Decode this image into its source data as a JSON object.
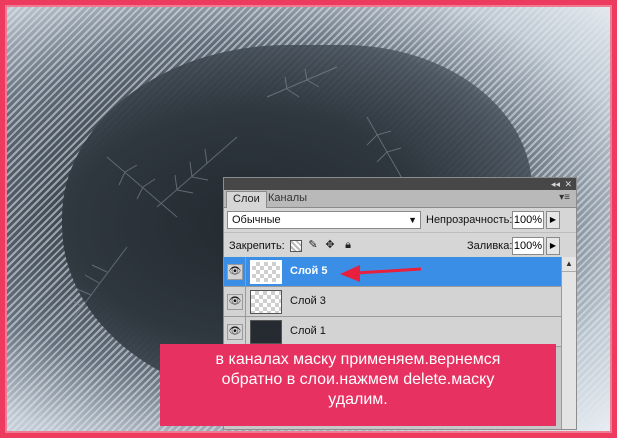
{
  "panel": {
    "tabs": [
      "Слои",
      "Каналы"
    ],
    "collapse_glyph": "◂◂",
    "close_glyph": "✕",
    "menu_glyph": "▾≡",
    "blend_mode": "Обычные",
    "opacity_label": "Непрозрачность:",
    "opacity_value": "100%",
    "lock_label": "Закрепить:",
    "fill_label": "Заливка:",
    "fill_value": "100%",
    "layers": [
      {
        "name": "Слой 5",
        "selected": true
      },
      {
        "name": "Слой 3",
        "selected": false
      },
      {
        "name": "Слой 1",
        "selected": false
      }
    ]
  },
  "note": {
    "text_line1": "в каналах маску применяем.вернемся",
    "text_line2": "обратно в слои.нажмем delete.маску",
    "text_line3": "удалим."
  },
  "colors": {
    "frame": "#ec3b5e",
    "note_bg": "#e73261",
    "selected_layer": "#3a8ee6",
    "arrow": "#e8203e"
  },
  "icons": {
    "eye": "eye-icon",
    "lock_transparent": "lock-transparency-icon",
    "lock_pixels": "brush-icon",
    "lock_position": "move-icon",
    "lock_all": "lock-icon"
  }
}
